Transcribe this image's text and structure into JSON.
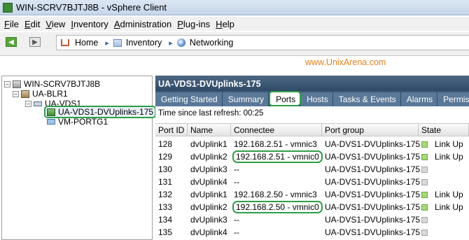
{
  "window": {
    "title": "WIN-SCRV7BJTJ8B - vSphere Client"
  },
  "menu": [
    "File",
    "Edit",
    "View",
    "Inventory",
    "Administration",
    "Plug-ins",
    "Help"
  ],
  "breadcrumb": [
    "Home",
    "Inventory",
    "Networking"
  ],
  "watermark": "www.UnixArena.com",
  "tree": {
    "root": "WIN-SCRV7BJTJ8B",
    "datacenter": "UA-BLR1",
    "vds": "UA-VDS1",
    "uplinks": "UA-VDS1-DVUplinks-175",
    "portgroup": "VM-PORTG1"
  },
  "panel": {
    "title": "UA-VDS1-DVUplinks-175",
    "tabs": [
      "Getting Started",
      "Summary",
      "Ports",
      "Hosts",
      "Tasks & Events",
      "Alarms",
      "Permission"
    ],
    "active_tab": "Ports",
    "refresh": "Time since last refresh: 00:25"
  },
  "table": {
    "columns": [
      "Port ID",
      "Name",
      "Connectee",
      "Port group",
      "State"
    ],
    "rows": [
      {
        "id": "128",
        "name": "dvUplink1",
        "connectee": "192.168.2.51 - vmnic3",
        "group": "UA-DVS1-DVUplinks-175",
        "state": "Link Up",
        "color": "#a8d878"
      },
      {
        "id": "129",
        "name": "dvUplink2",
        "connectee": "192.168.2.51 - vmnic0",
        "group": "UA-DVS1-DVUplinks-175",
        "state": "Link Up",
        "color": "#a8d878"
      },
      {
        "id": "130",
        "name": "dvUplink3",
        "connectee": "--",
        "group": "UA-DVS1-DVUplinks-175",
        "state": "",
        "color": "#d8d8d8"
      },
      {
        "id": "131",
        "name": "dvUplink4",
        "connectee": "--",
        "group": "UA-DVS1-DVUplinks-175",
        "state": "",
        "color": "#d8d8d8"
      },
      {
        "id": "132",
        "name": "dvUplink1",
        "connectee": "192.168.2.50 - vmnic3",
        "group": "UA-DVS1-DVUplinks-175",
        "state": "Link Up",
        "color": "#a8d878"
      },
      {
        "id": "133",
        "name": "dvUplink2",
        "connectee": "192.168.2.50 - vmnic0",
        "group": "UA-DVS1-DVUplinks-175",
        "state": "Link Up",
        "color": "#a8d878"
      },
      {
        "id": "134",
        "name": "dvUplink3",
        "connectee": "--",
        "group": "UA-DVS1-DVUplinks-175",
        "state": "",
        "color": "#d8d8d8"
      },
      {
        "id": "135",
        "name": "dvUplink4",
        "connectee": "--",
        "group": "UA-DVS1-DVUplinks-175",
        "state": "",
        "color": "#d8d8d8"
      }
    ]
  }
}
